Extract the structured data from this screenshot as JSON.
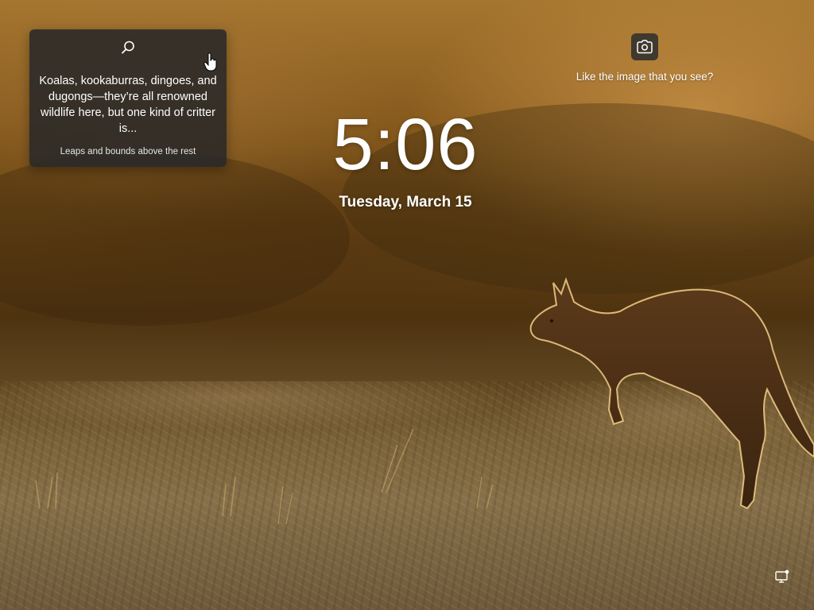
{
  "spotlight": {
    "text": "Koalas, kookaburras, dingoes, and dugongs—they’re all renowned wildlife here, but one kind of critter is...",
    "caption": "Leaps and bounds above the rest",
    "search_icon": "search-icon"
  },
  "feedback": {
    "label": "Like the image that you see?",
    "icon": "camera-icon"
  },
  "lockscreen": {
    "time": "5:06",
    "date": "Tuesday, March 15"
  },
  "status": {
    "network_icon": "network-icon"
  },
  "colors": {
    "card_bg": "#282828",
    "text": "#ffffff"
  }
}
